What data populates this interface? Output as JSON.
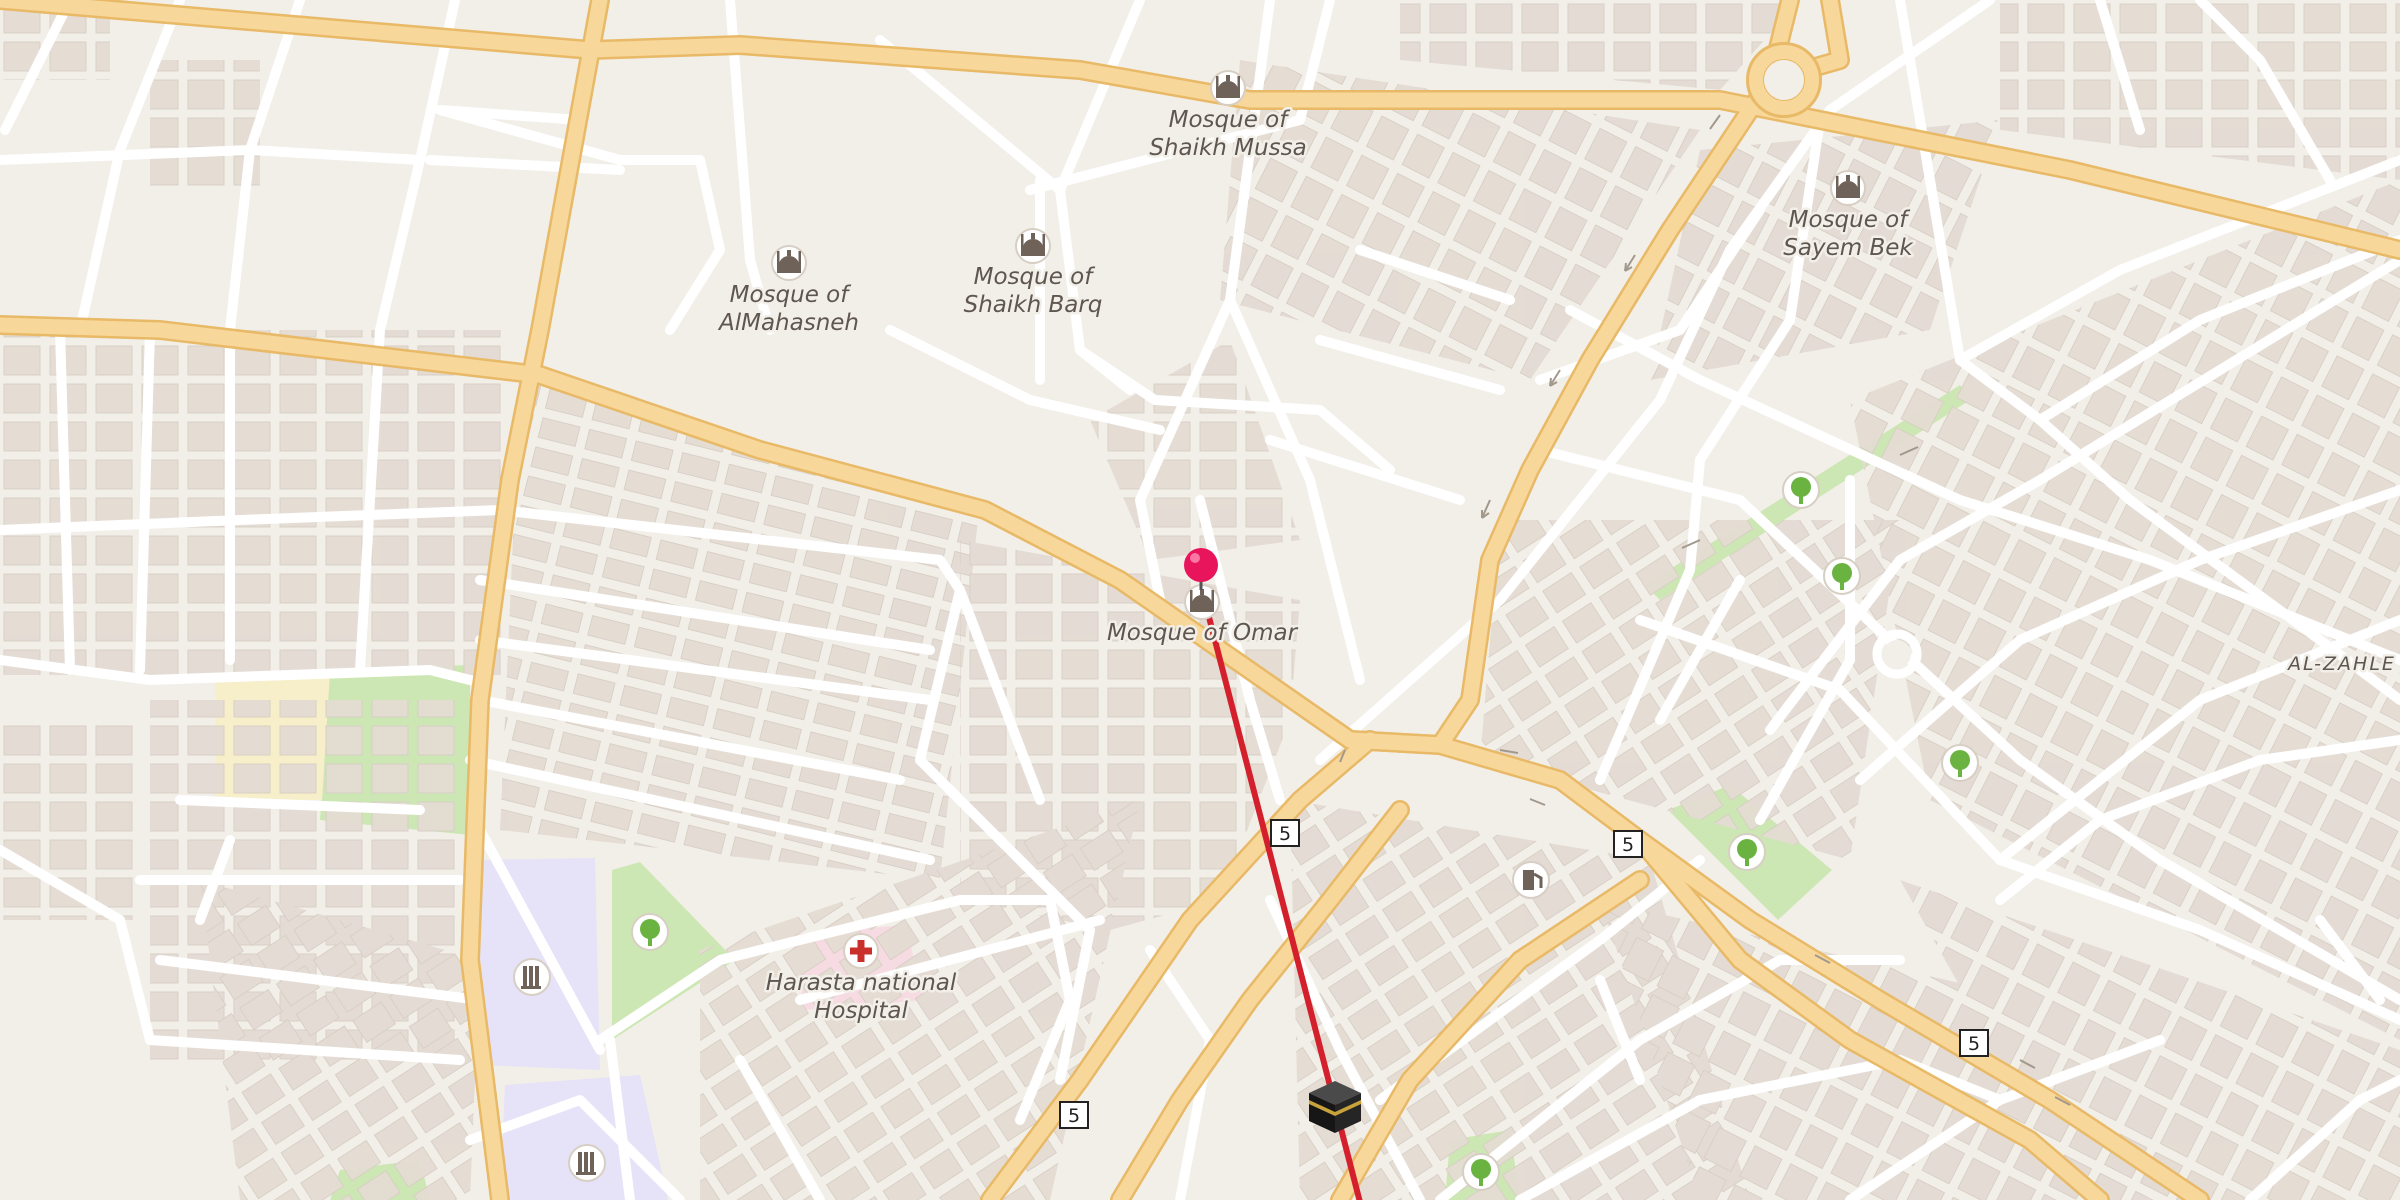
{
  "map": {
    "pois": [
      {
        "id": "poi-mosque-shaikh-mussa",
        "lines": [
          "Mosque of",
          "Shaikh Mussa"
        ],
        "icon": "mosque-icon"
      },
      {
        "id": "poi-mosque-sayem-bek",
        "lines": [
          "Mosque of",
          "Sayem Bek"
        ],
        "icon": "mosque-icon"
      },
      {
        "id": "poi-mosque-shaikh-barq",
        "lines": [
          "Mosque of",
          "Shaikh Barq"
        ],
        "icon": "mosque-icon"
      },
      {
        "id": "poi-mosque-almahasneh",
        "lines": [
          "Mosque of",
          "AlMahasneh"
        ],
        "icon": "mosque-icon"
      },
      {
        "id": "poi-mosque-omar",
        "lines": [
          "Mosque of Omar"
        ],
        "icon": "mosque-icon"
      },
      {
        "id": "poi-harasta-hospital",
        "lines": [
          "Harasta national",
          "Hospital"
        ],
        "icon": "hospital-cross-icon"
      }
    ],
    "area_labels": [
      {
        "id": "area-al-zahle",
        "text": "AL-ZAHLE"
      }
    ],
    "route_shields": [
      "5",
      "5",
      "5",
      "5"
    ],
    "markers": [
      {
        "id": "selected-location-pin",
        "icon": "map-pin-icon"
      },
      {
        "id": "qibla-kaaba-marker",
        "icon": "kaaba-icon"
      }
    ],
    "colors": {
      "background": "#f2efe9",
      "building": "#e4dcd3",
      "building_outline": "#d7cec4",
      "minor_road": "#ffffff",
      "major_road": "#f8d79a",
      "major_road_casing": "#e8b967",
      "park": "#cde7b4",
      "school": "#e6e2f7",
      "hospital_area": "#f7dbe3",
      "sand": "#f7efc9",
      "qibla_line": "#d4202d",
      "pin": "#e8145c",
      "poi_icon": "#6e6259",
      "tree_icon": "#6bb341",
      "hospital_cross": "#c9302c"
    }
  }
}
